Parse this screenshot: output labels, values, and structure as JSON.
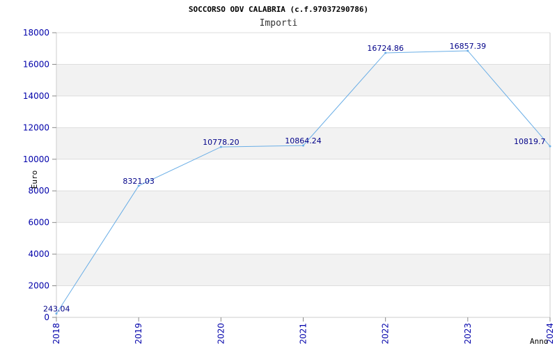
{
  "chart_data": {
    "type": "line",
    "title": "SOCCORSO ODV CALABRIA (c.f.97037290786)",
    "subtitle": "Importi",
    "xlabel": "Anno",
    "ylabel": "Euro",
    "x": [
      "2018",
      "2019",
      "2020",
      "2021",
      "2022",
      "2023",
      "2024"
    ],
    "series": [
      {
        "values": [
          243.04,
          8321.03,
          10778.2,
          10864.24,
          16724.86,
          16857.39,
          10819.7
        ],
        "labels": [
          "243.04",
          "8321.03",
          "10778.20",
          "10864.24",
          "16724.86",
          "16857.39",
          "10819.7"
        ]
      }
    ],
    "ylim": [
      0,
      18000
    ],
    "yticks": [
      "0",
      "2000",
      "4000",
      "6000",
      "8000",
      "10000",
      "12000",
      "14000",
      "16000",
      "18000"
    ],
    "grid": true,
    "line_color": "#6aaee6",
    "band_color": "#f2f2f2",
    "tick_color": "#0000aa"
  }
}
